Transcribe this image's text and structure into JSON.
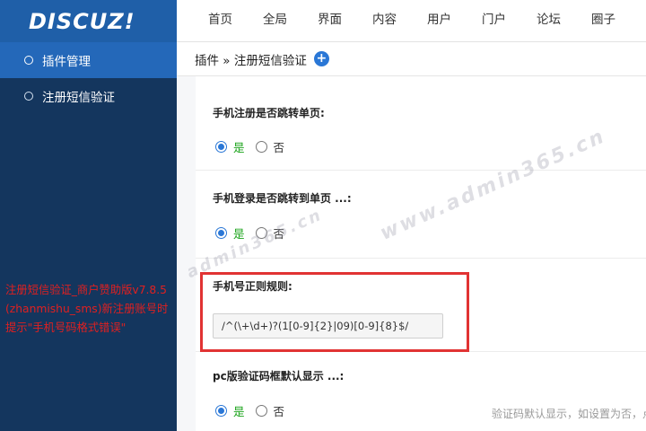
{
  "sidebar": {
    "logo": "DISCUZ!",
    "items": [
      {
        "label": "插件管理"
      },
      {
        "label": "注册短信验证"
      }
    ]
  },
  "topnav": {
    "items": [
      "首页",
      "全局",
      "界面",
      "内容",
      "用户",
      "门户",
      "论坛",
      "圈子"
    ]
  },
  "breadcrumb": {
    "path": "插件 » 注册短信验证",
    "add_icon": "+"
  },
  "form": {
    "sections": [
      {
        "title": "手机注册是否跳转单页:",
        "yes": "是",
        "no": "否",
        "selected": "yes"
      },
      {
        "title": "手机登录是否跳转到单页 ...:",
        "yes": "是",
        "no": "否",
        "selected": "yes"
      },
      {
        "title": "手机号正则规则:",
        "value": "/^(\\+\\d+)?(1[0-9]{2}|09)[0-9]{8}$/"
      },
      {
        "title": "pc版验证码框默认显示 ...:",
        "yes": "是",
        "no": "否",
        "selected": "yes",
        "hint": "验证码默认显示，如设置为否，点"
      }
    ]
  },
  "annotation": {
    "line1": "注册短信验证_商户赞助版v7.8.5",
    "line2": "(zhanmishu_sms)新注册账号时",
    "line3": "提示\"手机号码格式错误\""
  },
  "watermarks": [
    "www.admin365.cn",
    "admin365.cn"
  ],
  "colors": {
    "sidebar_bg": "#14365e",
    "logo_bg": "#1f5fa8",
    "active_item": "#2468b9",
    "accent": "#2a77d6",
    "highlight": "#e13333",
    "yes_text": "#1aa31a"
  }
}
